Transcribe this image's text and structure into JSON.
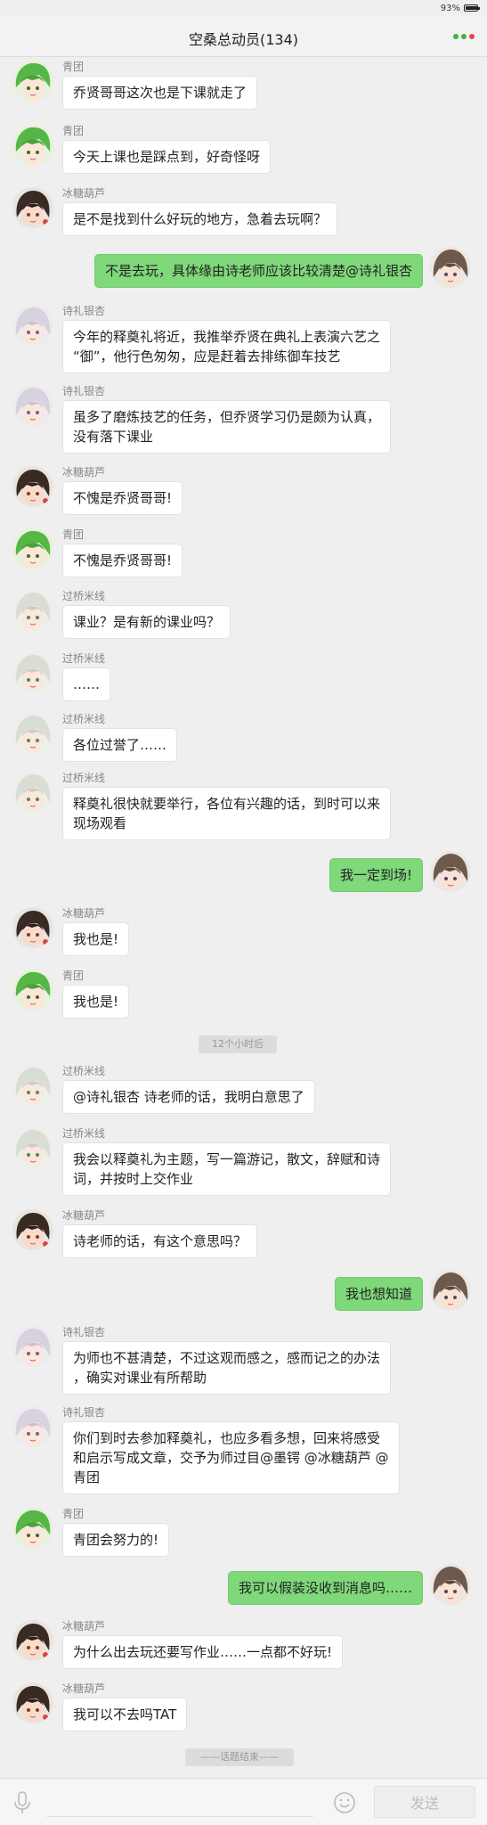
{
  "status_bar": {
    "battery": "93%",
    "battery_level": 0.93
  },
  "header": {
    "title": "空桑总动员(134)"
  },
  "colors": {
    "green_bubble": "#7fd87a",
    "send_button_text": "#bdbdbd"
  },
  "messages": [
    {
      "sender": "青团",
      "text": "乔贤哥哥这次也是下课就走了"
    },
    {
      "sender": "青团",
      "text": "今天上课也是踩点到，好奇怪呀"
    },
    {
      "sender": "冰糖葫芦",
      "text": "是不是找到什么好玩的地方，急着去玩啊？"
    },
    {
      "sender": "",
      "text": "不是去玩，具体缘由诗老师应该比较清楚@诗礼银杏"
    },
    {
      "sender": "诗礼银杏",
      "text": "今年的释奠礼将近，我推举乔贤在典礼上表演六艺之",
      "text2": "“御”，他行色匆匆，应是赶着去排练御车技艺"
    },
    {
      "sender": "诗礼银杏",
      "text": "虽多了磨炼技艺的任务，但乔贤学习仍是颇为认真，",
      "text2": "没有落下课业"
    },
    {
      "sender": "冰糖葫芦",
      "text": "不愧是乔贤哥哥!"
    },
    {
      "sender": "青团",
      "text": "不愧是乔贤哥哥!"
    },
    {
      "sender": "过桥米线",
      "text": "课业？是有新的课业吗？"
    },
    {
      "sender": "过桥米线",
      "text": "……"
    },
    {
      "sender": "过桥米线",
      "text": "各位过誉了……"
    },
    {
      "sender": "过桥米线",
      "text": "释奠礼很快就要举行，各位有兴趣的话，到时可以来",
      "text2": "现场观看"
    },
    {
      "sender": "",
      "text": "我一定到场!"
    },
    {
      "sender": "冰糖葫芦",
      "text": "我也是!"
    },
    {
      "sender": "青团",
      "text": "我也是!"
    },
    {
      "sender": "过桥米线",
      "text": "@诗礼银杏 诗老师的话，我明白意思了"
    },
    {
      "sender": "过桥米线",
      "text": "我会以释奠礼为主题，写一篇游记，散文，辞赋和诗",
      "text2": "词，并按时上交作业"
    },
    {
      "sender": "冰糖葫芦",
      "text": "诗老师的话，有这个意思吗？"
    },
    {
      "sender": "",
      "text": "我也想知道"
    },
    {
      "sender": "诗礼银杏",
      "text": "为师也不甚清楚，不过这观而感之，感而记之的办法",
      "text2": "，确实对课业有所帮助"
    },
    {
      "sender": "诗礼银杏",
      "text": "你们到时去参加释奠礼，也应多看多想，回来将感受",
      "text2": "和启示写成文章，交予为师过目@墨锷 @冰糖葫芦 @",
      "text3": "青团"
    },
    {
      "sender": "青团",
      "text": "青团会努力的!"
    },
    {
      "sender": "",
      "text": "我可以假装没收到消息吗……"
    },
    {
      "sender": "冰糖葫芦",
      "text": "为什么出去玩还要写作业……一点都不好玩!"
    },
    {
      "sender": "冰糖葫芦",
      "text": "我可以不去吗TAT"
    }
  ],
  "timestamp": "12个小时后",
  "end_marker": "——话题结束——",
  "input_bar": {
    "send_label": "发送",
    "placeholder": ""
  }
}
